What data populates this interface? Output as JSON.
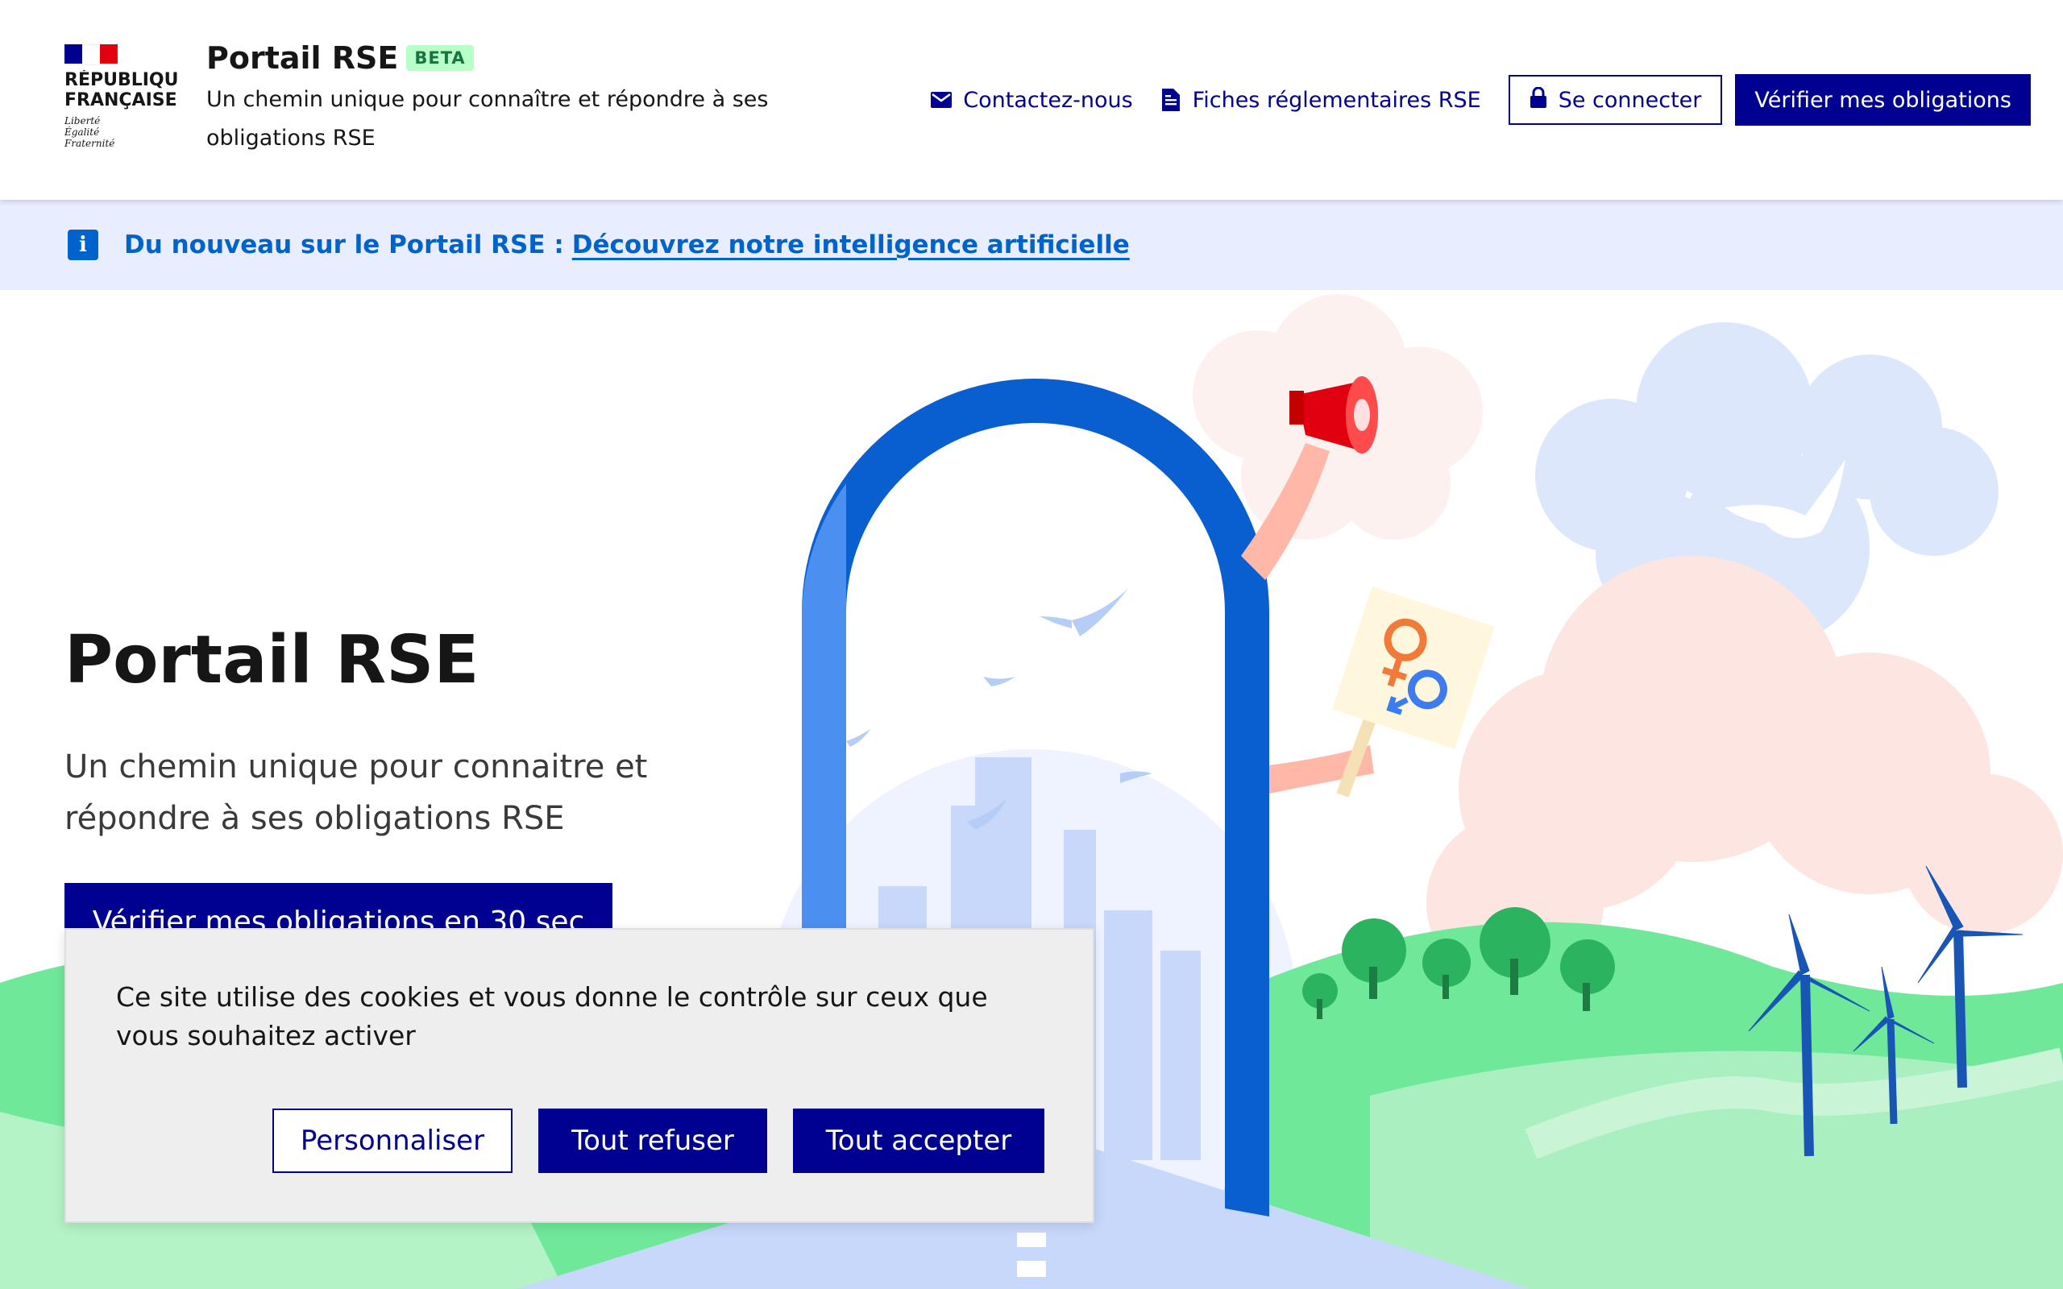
{
  "header": {
    "republic_name": "RÉPUBLIQU\nFRANÇAISE",
    "devise": "Liberté\nÉgalité\nFraternité",
    "service_title": "Portail RSE",
    "badge": "BETA",
    "tagline": "Un chemin unique pour connaître et répondre à ses obligations RSE",
    "nav": {
      "contact": "Contactez-nous",
      "fiches": "Fiches réglementaires RSE",
      "login": "Se connecter",
      "verify": "Vérifier mes obligations"
    }
  },
  "notice": {
    "icon": "info-icon",
    "text": "Du nouveau sur le Portail RSE :",
    "link": "Découvrez notre intelligence artificielle"
  },
  "hero": {
    "title": "Portail RSE",
    "subtitle": "Un chemin unique pour connaitre et répondre à ses obligations RSE",
    "cta": "Vérifier mes obligations en 30 sec"
  },
  "cookie": {
    "text": "Ce site utilise des cookies et vous donne le contrôle sur ceux que vous souhaitez activer",
    "customize": "Personnaliser",
    "refuse": "Tout refuser",
    "accept": "Tout accepter"
  },
  "colors": {
    "primary": "#000091",
    "info": "#0063cb",
    "notice_bg": "#e8edff",
    "badge_bg": "#b8fec9",
    "badge_text": "#18753c",
    "arch": "#0a5fd0",
    "grass": "#6fe89a"
  }
}
